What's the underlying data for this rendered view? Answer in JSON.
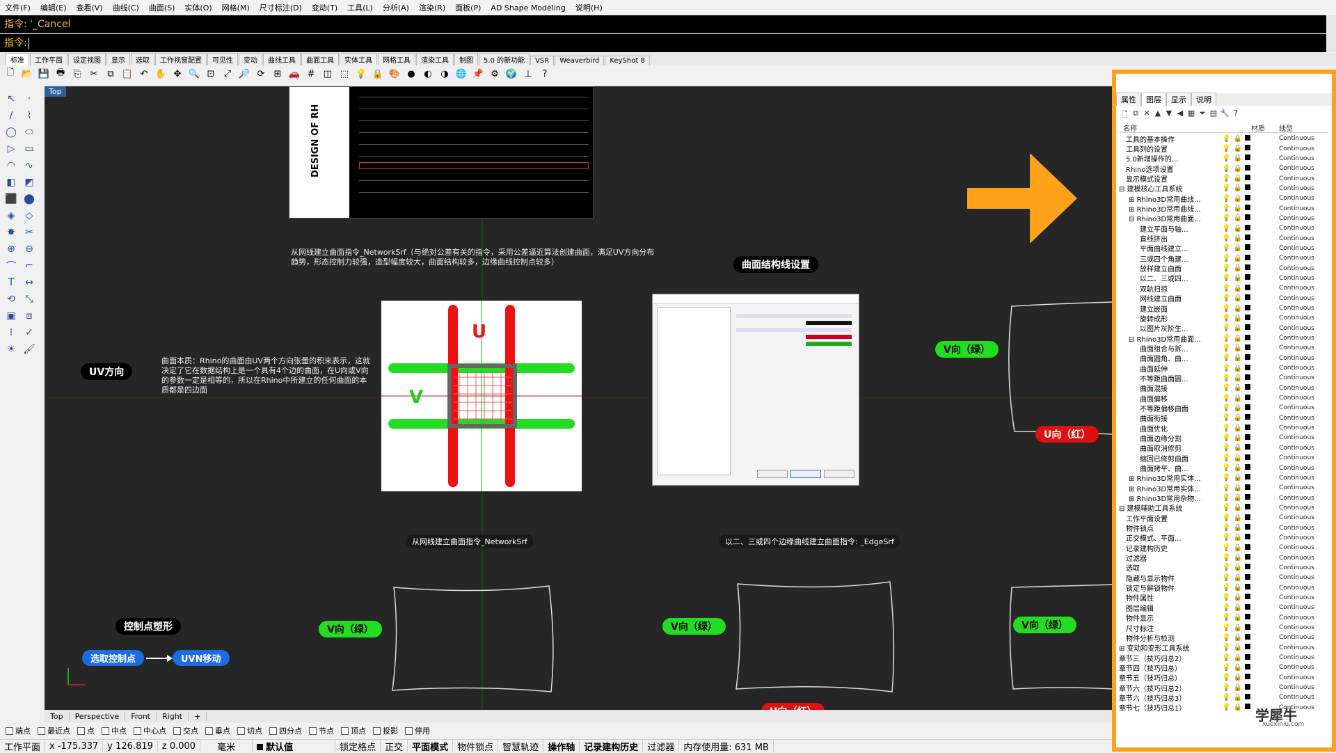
{
  "menu": [
    "文件(F)",
    "编辑(E)",
    "查看(V)",
    "曲线(C)",
    "曲面(S)",
    "实体(O)",
    "网格(M)",
    "尺寸标注(D)",
    "变动(T)",
    "工具(L)",
    "分析(A)",
    "渲染(R)",
    "面板(P)",
    "AD Shape Modeling",
    "说明(H)"
  ],
  "command": {
    "history": "指令: '_Cancel",
    "prompt": "指令:"
  },
  "toolbar_tabs": [
    "标准",
    "工作平面",
    "设定视图",
    "显示",
    "选取",
    "工作视窗配置",
    "可见性",
    "变动",
    "曲线工具",
    "曲面工具",
    "实体工具",
    "网格工具",
    "渲染工具",
    "制图",
    "5.0 的新功能",
    "VSR",
    "Weaverbird",
    "KeyShot 8"
  ],
  "viewport": {
    "label": "Top",
    "pills": {
      "uv_dir": "UV方向",
      "curve_struct": "曲面结构线设置",
      "v_green_1": "V向（绿）",
      "u_red_1": "U向（红）",
      "ctrl_sculpt": "控制点塑形",
      "select_cp": "选取控制点",
      "uvn_move": "UVN移动",
      "v_green_2": "V向（绿）",
      "v_green_3": "V向（绿）",
      "v_green_4": "V向（绿）",
      "u_red_2": "U向（红）"
    },
    "networksrf_note": "从网线建立曲面指令_NetworkSrf（与绝对公差有关的指令，采用公差逼近算法创建曲面，满足UV方向分布趋势，形态控制力较强，造型幅度较大，曲面结构较多，边缘曲线控制点较多）",
    "uv_note": "曲面本质：Rhino的曲面由UV两个方向张量的积来表示，这就决定了它在数据结构上是一个具有4个边的曲面，在U向或V向的参数一定是相等的，所以在Rhino中所建立的任何曲面的本质都是四边面",
    "caption_network": "从网线建立曲面指令_NetworkSrf",
    "caption_edgesrf": "以二、三或四个边缘曲线建立曲面指令: _EdgeSrf",
    "book_title": "DESIGN OF RH",
    "u_letter": "U",
    "v_letter": "V"
  },
  "view_tabs": [
    "Top",
    "Perspective",
    "Front",
    "Right",
    "+"
  ],
  "osnaps": [
    "端点",
    "最近点",
    "点",
    "中点",
    "中心点",
    "交点",
    "垂点",
    "切点",
    "四分点",
    "节点",
    "顶点",
    "投影",
    "停用"
  ],
  "status": {
    "cplane": "工作平面",
    "x": "x -175.337",
    "y": "y 126.819",
    "z": "z 0.000",
    "unit": "毫米",
    "layer": "默认值",
    "grid_snap": "锁定格点",
    "ortho": "正交",
    "planar": "平面模式",
    "osnap": "物件锁点",
    "smarttrack": "智慧轨迹",
    "gumball": "操作轴",
    "history": "记录建构历史",
    "filter": "过滤器",
    "memory": "内存使用量: 631 MB"
  },
  "panel": {
    "tabs": [
      "属性",
      "图层",
      "显示",
      "说明"
    ],
    "columns": {
      "name": "名称",
      "material": "材质",
      "linetype": "线型"
    },
    "linetype": "Continuous",
    "layers": [
      "工具的基本操作",
      "工具列的设置",
      "5.0新增操作的...",
      "Rhino选项设置",
      "显示模式设置",
      "⊟ 建模核心工具系统",
      "⊞ Rhino3D常用曲线...",
      "⊞ Rhino3D常用曲线...",
      "⊟ Rhino3D常用曲面...",
      "建立平面与轴...",
      "直线挤出",
      "平面曲线建立...",
      "三或四个角建...",
      "放样建立曲面",
      "以二、三或四...",
      "双轨扫掠",
      "网线建立曲面",
      "建立嵌面",
      "旋转成形",
      "以图片灰阶生...",
      "⊟ Rhino3D常用曲面...",
      "曲面组合与拆...",
      "曲面圆角、曲...",
      "曲面延伸",
      "不等距曲面圆...",
      "曲面混接",
      "曲面偏移",
      "不等距偏移曲面",
      "曲面衔接",
      "曲面优化",
      "曲面边缘分割",
      "曲面取消修剪",
      "缩回已修剪曲面",
      "曲面拷平、曲...",
      "⊞ Rhino3D常用实体...",
      "⊞ Rhino3D常用实体...",
      "⊞ Rhino3D常用杂物...",
      "⊟ 建模辅助工具系统",
      "工作平面设置",
      "物件锁点",
      "正交模式、平面...",
      "记录建构历史",
      "过滤器",
      "选取",
      "隐藏与显示物件",
      "锁定与解锁物件",
      "物件属性",
      "图层编辑",
      "物件显示",
      "尺寸标注",
      "物件分析与检测",
      "⊞ 变动和变形工具系统",
      "章节三（技巧归总2）",
      "章节四（技巧归总）",
      "章节五（技巧归总）",
      "章节六（技巧归总2）",
      "章节六（技巧归总3）",
      "章节七（技巧归总1）"
    ],
    "watermark": "学犀牛",
    "watermark_url": "xuexiniu.com"
  },
  "colors": {
    "accent": "#ffa21a",
    "viewport_bg": "#262626",
    "green": "#22dd22",
    "red": "#dd1111",
    "blue": "#1a6ce0"
  }
}
